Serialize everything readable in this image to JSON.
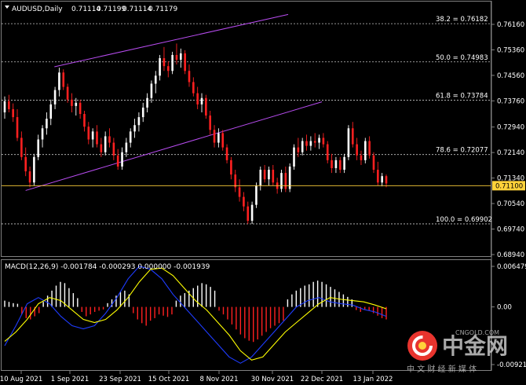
{
  "chart_data": [
    {
      "type": "candlestick",
      "title": "AUDUSD,Daily",
      "header_values": [
        "0.71114",
        "0.71199",
        "0.71114",
        "0.71179"
      ],
      "price_axis": {
        "ticks": [
          "0.76160",
          "0.75360",
          "0.74560",
          "0.73760",
          "0.72940",
          "0.72140",
          "0.71340",
          "0.70540",
          "0.69740",
          "0.68940"
        ],
        "tick_values": [
          0.7616,
          0.7536,
          0.7456,
          0.7376,
          0.7294,
          0.7214,
          0.7134,
          0.7054,
          0.6974,
          0.6894
        ],
        "current_price": "0.71100",
        "current_value": 0.711
      },
      "fib_levels": [
        {
          "label": "38.2 = 0.76182",
          "value": 0.76182
        },
        {
          "label": "50.0 = 0.74983",
          "value": 0.74983
        },
        {
          "label": "61.8 = 0.73784",
          "value": 0.73784
        },
        {
          "label": "78.6 = 0.72077",
          "value": 0.72077
        },
        {
          "label": "100.0 = 0.69902",
          "value": 0.69902
        }
      ],
      "channel": {
        "upper": [
          {
            "date": "2021-08-25",
            "price": 0.7483
          },
          {
            "date": "2021-12-07",
            "price": 0.7647
          }
        ],
        "lower": [
          {
            "date": "2021-08-12",
            "price": 0.7095
          },
          {
            "date": "2021-12-22",
            "price": 0.7373
          }
        ]
      },
      "x_labels": [
        "10 Aug 2021",
        "1 Sep 2021",
        "23 Sep 2021",
        "15 Oct 2021",
        "8 Nov 2021",
        "30 Nov 2021",
        "22 Dec 2021",
        "13 Jan 2022"
      ],
      "candles": [
        {
          "o": 0.734,
          "h": 0.739,
          "l": 0.732,
          "c": 0.7375
        },
        {
          "o": 0.7375,
          "h": 0.7395,
          "l": 0.734,
          "c": 0.735
        },
        {
          "o": 0.735,
          "h": 0.7368,
          "l": 0.731,
          "c": 0.7325
        },
        {
          "o": 0.7325,
          "h": 0.735,
          "l": 0.725,
          "c": 0.726
        },
        {
          "o": 0.726,
          "h": 0.728,
          "l": 0.719,
          "c": 0.72
        },
        {
          "o": 0.72,
          "h": 0.723,
          "l": 0.714,
          "c": 0.7155
        },
        {
          "o": 0.7155,
          "h": 0.717,
          "l": 0.7105,
          "c": 0.712
        },
        {
          "o": 0.712,
          "h": 0.721,
          "l": 0.711,
          "c": 0.72
        },
        {
          "o": 0.72,
          "h": 0.727,
          "l": 0.719,
          "c": 0.7255
        },
        {
          "o": 0.7255,
          "h": 0.73,
          "l": 0.723,
          "c": 0.729
        },
        {
          "o": 0.729,
          "h": 0.734,
          "l": 0.727,
          "c": 0.732
        },
        {
          "o": 0.732,
          "h": 0.738,
          "l": 0.73,
          "c": 0.7365
        },
        {
          "o": 0.7365,
          "h": 0.742,
          "l": 0.735,
          "c": 0.741
        },
        {
          "o": 0.741,
          "h": 0.748,
          "l": 0.739,
          "c": 0.7465
        },
        {
          "o": 0.7465,
          "h": 0.7475,
          "l": 0.741,
          "c": 0.742
        },
        {
          "o": 0.742,
          "h": 0.743,
          "l": 0.737,
          "c": 0.738
        },
        {
          "o": 0.738,
          "h": 0.74,
          "l": 0.734,
          "c": 0.736
        },
        {
          "o": 0.736,
          "h": 0.7385,
          "l": 0.733,
          "c": 0.737
        },
        {
          "o": 0.737,
          "h": 0.738,
          "l": 0.732,
          "c": 0.7335
        },
        {
          "o": 0.7335,
          "h": 0.7345,
          "l": 0.728,
          "c": 0.7295
        },
        {
          "o": 0.7295,
          "h": 0.731,
          "l": 0.724,
          "c": 0.7255
        },
        {
          "o": 0.7255,
          "h": 0.729,
          "l": 0.723,
          "c": 0.728
        },
        {
          "o": 0.728,
          "h": 0.73,
          "l": 0.723,
          "c": 0.724
        },
        {
          "o": 0.724,
          "h": 0.726,
          "l": 0.72,
          "c": 0.7215
        },
        {
          "o": 0.7215,
          "h": 0.728,
          "l": 0.7205,
          "c": 0.7265
        },
        {
          "o": 0.7265,
          "h": 0.729,
          "l": 0.723,
          "c": 0.7245
        },
        {
          "o": 0.7245,
          "h": 0.726,
          "l": 0.719,
          "c": 0.7205
        },
        {
          "o": 0.7205,
          "h": 0.7225,
          "l": 0.716,
          "c": 0.717
        },
        {
          "o": 0.717,
          "h": 0.723,
          "l": 0.716,
          "c": 0.7215
        },
        {
          "o": 0.7215,
          "h": 0.726,
          "l": 0.72,
          "c": 0.7245
        },
        {
          "o": 0.7245,
          "h": 0.729,
          "l": 0.723,
          "c": 0.728
        },
        {
          "o": 0.728,
          "h": 0.732,
          "l": 0.726,
          "c": 0.73
        },
        {
          "o": 0.73,
          "h": 0.734,
          "l": 0.728,
          "c": 0.7325
        },
        {
          "o": 0.7325,
          "h": 0.737,
          "l": 0.731,
          "c": 0.7355
        },
        {
          "o": 0.7355,
          "h": 0.74,
          "l": 0.734,
          "c": 0.7385
        },
        {
          "o": 0.7385,
          "h": 0.744,
          "l": 0.737,
          "c": 0.743
        },
        {
          "o": 0.743,
          "h": 0.747,
          "l": 0.74,
          "c": 0.7455
        },
        {
          "o": 0.7455,
          "h": 0.752,
          "l": 0.744,
          "c": 0.751
        },
        {
          "o": 0.751,
          "h": 0.7545,
          "l": 0.747,
          "c": 0.7485
        },
        {
          "o": 0.7485,
          "h": 0.75,
          "l": 0.745,
          "c": 0.747
        },
        {
          "o": 0.747,
          "h": 0.753,
          "l": 0.746,
          "c": 0.752
        },
        {
          "o": 0.752,
          "h": 0.7556,
          "l": 0.749,
          "c": 0.7505
        },
        {
          "o": 0.7505,
          "h": 0.754,
          "l": 0.748,
          "c": 0.7525
        },
        {
          "o": 0.7525,
          "h": 0.7535,
          "l": 0.746,
          "c": 0.747
        },
        {
          "o": 0.747,
          "h": 0.749,
          "l": 0.742,
          "c": 0.7435
        },
        {
          "o": 0.7435,
          "h": 0.745,
          "l": 0.739,
          "c": 0.74
        },
        {
          "o": 0.74,
          "h": 0.742,
          "l": 0.735,
          "c": 0.7365
        },
        {
          "o": 0.7365,
          "h": 0.74,
          "l": 0.734,
          "c": 0.7385
        },
        {
          "o": 0.7385,
          "h": 0.7395,
          "l": 0.732,
          "c": 0.733
        },
        {
          "o": 0.733,
          "h": 0.7345,
          "l": 0.727,
          "c": 0.7285
        },
        {
          "o": 0.7285,
          "h": 0.73,
          "l": 0.723,
          "c": 0.7245
        },
        {
          "o": 0.7245,
          "h": 0.729,
          "l": 0.723,
          "c": 0.7275
        },
        {
          "o": 0.7275,
          "h": 0.7285,
          "l": 0.722,
          "c": 0.723
        },
        {
          "o": 0.723,
          "h": 0.724,
          "l": 0.718,
          "c": 0.719
        },
        {
          "o": 0.719,
          "h": 0.72,
          "l": 0.713,
          "c": 0.7145
        },
        {
          "o": 0.7145,
          "h": 0.716,
          "l": 0.709,
          "c": 0.7105
        },
        {
          "o": 0.7105,
          "h": 0.713,
          "l": 0.706,
          "c": 0.7075
        },
        {
          "o": 0.7075,
          "h": 0.709,
          "l": 0.703,
          "c": 0.7045
        },
        {
          "o": 0.7045,
          "h": 0.706,
          "l": 0.699,
          "c": 0.7
        },
        {
          "o": 0.7,
          "h": 0.706,
          "l": 0.699,
          "c": 0.705
        },
        {
          "o": 0.705,
          "h": 0.712,
          "l": 0.704,
          "c": 0.711
        },
        {
          "o": 0.711,
          "h": 0.717,
          "l": 0.7095,
          "c": 0.716
        },
        {
          "o": 0.716,
          "h": 0.7175,
          "l": 0.712,
          "c": 0.713
        },
        {
          "o": 0.713,
          "h": 0.717,
          "l": 0.711,
          "c": 0.716
        },
        {
          "o": 0.716,
          "h": 0.7175,
          "l": 0.711,
          "c": 0.712
        },
        {
          "o": 0.712,
          "h": 0.7135,
          "l": 0.7085,
          "c": 0.71
        },
        {
          "o": 0.71,
          "h": 0.716,
          "l": 0.709,
          "c": 0.715
        },
        {
          "o": 0.715,
          "h": 0.717,
          "l": 0.709,
          "c": 0.71
        },
        {
          "o": 0.71,
          "h": 0.718,
          "l": 0.709,
          "c": 0.717
        },
        {
          "o": 0.717,
          "h": 0.724,
          "l": 0.716,
          "c": 0.723
        },
        {
          "o": 0.723,
          "h": 0.726,
          "l": 0.72,
          "c": 0.7215
        },
        {
          "o": 0.7215,
          "h": 0.726,
          "l": 0.7205,
          "c": 0.725
        },
        {
          "o": 0.725,
          "h": 0.727,
          "l": 0.722,
          "c": 0.7235
        },
        {
          "o": 0.7235,
          "h": 0.7265,
          "l": 0.722,
          "c": 0.725
        },
        {
          "o": 0.725,
          "h": 0.7275,
          "l": 0.723,
          "c": 0.7245
        },
        {
          "o": 0.7245,
          "h": 0.727,
          "l": 0.7225,
          "c": 0.726
        },
        {
          "o": 0.726,
          "h": 0.7275,
          "l": 0.723,
          "c": 0.724
        },
        {
          "o": 0.724,
          "h": 0.725,
          "l": 0.718,
          "c": 0.719
        },
        {
          "o": 0.719,
          "h": 0.721,
          "l": 0.715,
          "c": 0.7165
        },
        {
          "o": 0.7165,
          "h": 0.72,
          "l": 0.715,
          "c": 0.719
        },
        {
          "o": 0.719,
          "h": 0.72,
          "l": 0.715,
          "c": 0.716
        },
        {
          "o": 0.716,
          "h": 0.721,
          "l": 0.715,
          "c": 0.72
        },
        {
          "o": 0.72,
          "h": 0.73,
          "l": 0.719,
          "c": 0.729
        },
        {
          "o": 0.729,
          "h": 0.731,
          "l": 0.723,
          "c": 0.724
        },
        {
          "o": 0.724,
          "h": 0.726,
          "l": 0.719,
          "c": 0.7205
        },
        {
          "o": 0.7205,
          "h": 0.722,
          "l": 0.7175,
          "c": 0.719
        },
        {
          "o": 0.719,
          "h": 0.726,
          "l": 0.718,
          "c": 0.725
        },
        {
          "o": 0.725,
          "h": 0.7265,
          "l": 0.7195,
          "c": 0.7205
        },
        {
          "o": 0.7205,
          "h": 0.7215,
          "l": 0.715,
          "c": 0.716
        },
        {
          "o": 0.716,
          "h": 0.7185,
          "l": 0.711,
          "c": 0.712
        },
        {
          "o": 0.712,
          "h": 0.715,
          "l": 0.7108,
          "c": 0.714
        },
        {
          "o": 0.714,
          "h": 0.7145,
          "l": 0.7105,
          "c": 0.7117
        }
      ]
    },
    {
      "type": "bar_line",
      "title": "MACD(12,26,9) -0.001784 -0.000293 0.000000 -0.001939",
      "y_axis": {
        "ticks": [
          "0.006479",
          "0.00",
          "-0.009215"
        ],
        "tick_values": [
          0.006479,
          0.0,
          -0.009215
        ]
      },
      "series": [
        {
          "name": "-0.001784",
          "kind": "histogram",
          "color": "#ffffff"
        },
        {
          "name": "-0.000293",
          "kind": "line",
          "color": "#ffff00"
        },
        {
          "name": "0.000000",
          "kind": "line",
          "color": "#1e3cff"
        },
        {
          "name": "-0.001939",
          "kind": "histogram-negative",
          "color": "#ff2020"
        }
      ],
      "macd_signal": [
        -0.0055,
        -0.004,
        -0.002,
        0.0005,
        0.0015,
        0.001,
        -0.0005,
        -0.002,
        -0.0025,
        -0.002,
        -0.0005,
        0.0015,
        0.004,
        0.006,
        0.0062,
        0.005,
        0.003,
        0.001,
        -0.0005,
        -0.0025,
        -0.0045,
        -0.007,
        -0.0085,
        -0.008,
        -0.006,
        -0.004,
        -0.0025,
        -0.001,
        0.0005,
        0.0015,
        0.0012,
        0.001,
        0.0008,
        0.0003,
        -0.0003
      ],
      "macd_main": [
        -0.0062,
        -0.003,
        0.0005,
        0.0015,
        0.0005,
        -0.0015,
        -0.003,
        -0.0035,
        -0.003,
        -0.001,
        0.0015,
        0.0045,
        0.0065,
        0.006,
        0.0045,
        0.002,
        0.0,
        -0.002,
        -0.004,
        -0.006,
        -0.008,
        -0.009,
        -0.008,
        -0.006,
        -0.004,
        -0.002,
        0.0,
        0.001,
        0.0015,
        0.0008,
        0.0005,
        0.0003,
        -0.0004,
        -0.0008,
        -0.0015
      ],
      "histogram_bars": [
        0.001,
        0.0008,
        0.0006,
        0.0005,
        -0.0012,
        -0.0018,
        -0.002,
        -0.0015,
        -0.001,
        0.0008,
        0.0018,
        0.0026,
        0.0034,
        0.004,
        0.0038,
        0.003,
        0.0022,
        0.0014,
        -0.0008,
        -0.0015,
        -0.0012,
        -0.0008,
        -0.0006,
        -0.0004,
        0.0006,
        0.0012,
        0.0018,
        0.0024,
        0.0026,
        0.002,
        -0.001,
        -0.002,
        -0.0026,
        -0.003,
        -0.0022,
        -0.0018,
        -0.0012,
        -0.0014,
        -0.0016,
        -0.0012,
        0.001,
        0.0018,
        0.0022,
        0.0026,
        0.003,
        0.0034,
        0.0038,
        0.0036,
        0.0032,
        0.0026,
        -0.0006,
        -0.0012,
        -0.002,
        -0.0028,
        -0.0036,
        -0.0044,
        -0.005,
        -0.0054,
        -0.0056,
        -0.0052,
        -0.0046,
        -0.004,
        -0.0034,
        -0.003,
        -0.0026,
        -0.0022,
        0.0012,
        0.002,
        0.0026,
        0.003,
        0.0034,
        0.0036,
        0.004,
        0.0042,
        0.004,
        0.0036,
        0.0032,
        0.0028,
        0.0024,
        0.002,
        0.0016,
        0.0012,
        -0.0005,
        -0.0008,
        -0.0004,
        -0.0006,
        -0.001,
        -0.0014,
        -0.0018,
        -0.002
      ]
    }
  ],
  "watermark": {
    "logo_text": "中金网",
    "site": "CNGOLD.COM",
    "slogan": "中 文 财 经 新 媒 体"
  }
}
